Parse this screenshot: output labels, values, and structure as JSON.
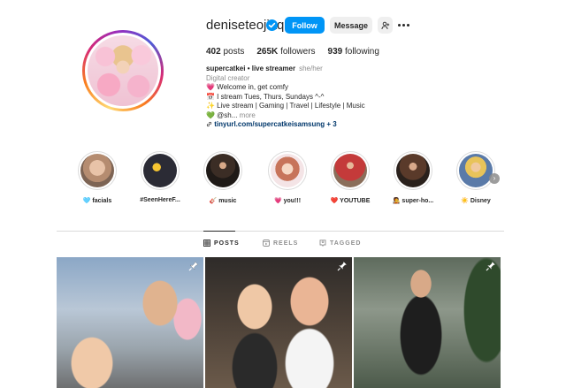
{
  "profile": {
    "username": "deniseteojiaqi",
    "follow_label": "Follow",
    "message_label": "Message",
    "stats": {
      "posts_count": "402",
      "posts_label": "posts",
      "followers_count": "265K",
      "followers_label": "followers",
      "following_count": "939",
      "following_label": "following"
    },
    "bio": {
      "name": "supercatkei • live streamer",
      "pronouns": "she/her",
      "category": "Digital creator",
      "lines": [
        "💗 Welcome in, get comfy",
        "📅 I stream Tues, Thurs, Sundays ^-^",
        "✨ Live stream | Gaming | Travel | Lifestyle | Music",
        "💚 @sh..."
      ],
      "more_label": "more",
      "link_text": "tinyurl.com/supercatkeisamsung + 3"
    }
  },
  "highlights": [
    {
      "label": "🩵 facials",
      "color": "#cfa58a"
    },
    {
      "label": "#SeenHereF...",
      "color": "#2b2b35"
    },
    {
      "label": "🎸 music",
      "color": "#4a3a2e"
    },
    {
      "label": "💗 you!!!",
      "color": "#f1c4c4"
    },
    {
      "label": "❤️ YOUTUBE",
      "color": "#c43a3a"
    },
    {
      "label": "🧑‍🎤 super-ho...",
      "color": "#3d2f27"
    },
    {
      "label": "☀️ Disney",
      "color": "#5a7aa8"
    }
  ],
  "tabs": [
    {
      "label": "POSTS",
      "icon": "grid-icon",
      "active": true
    },
    {
      "label": "REELS",
      "icon": "reels-icon",
      "active": false
    },
    {
      "label": "TAGGED",
      "icon": "tag-icon",
      "active": false
    }
  ],
  "colors": {
    "accent": "#0095f6",
    "text": "#262626",
    "muted": "#8e8e8e",
    "link": "#00376b",
    "divider": "#dbdbdb"
  }
}
